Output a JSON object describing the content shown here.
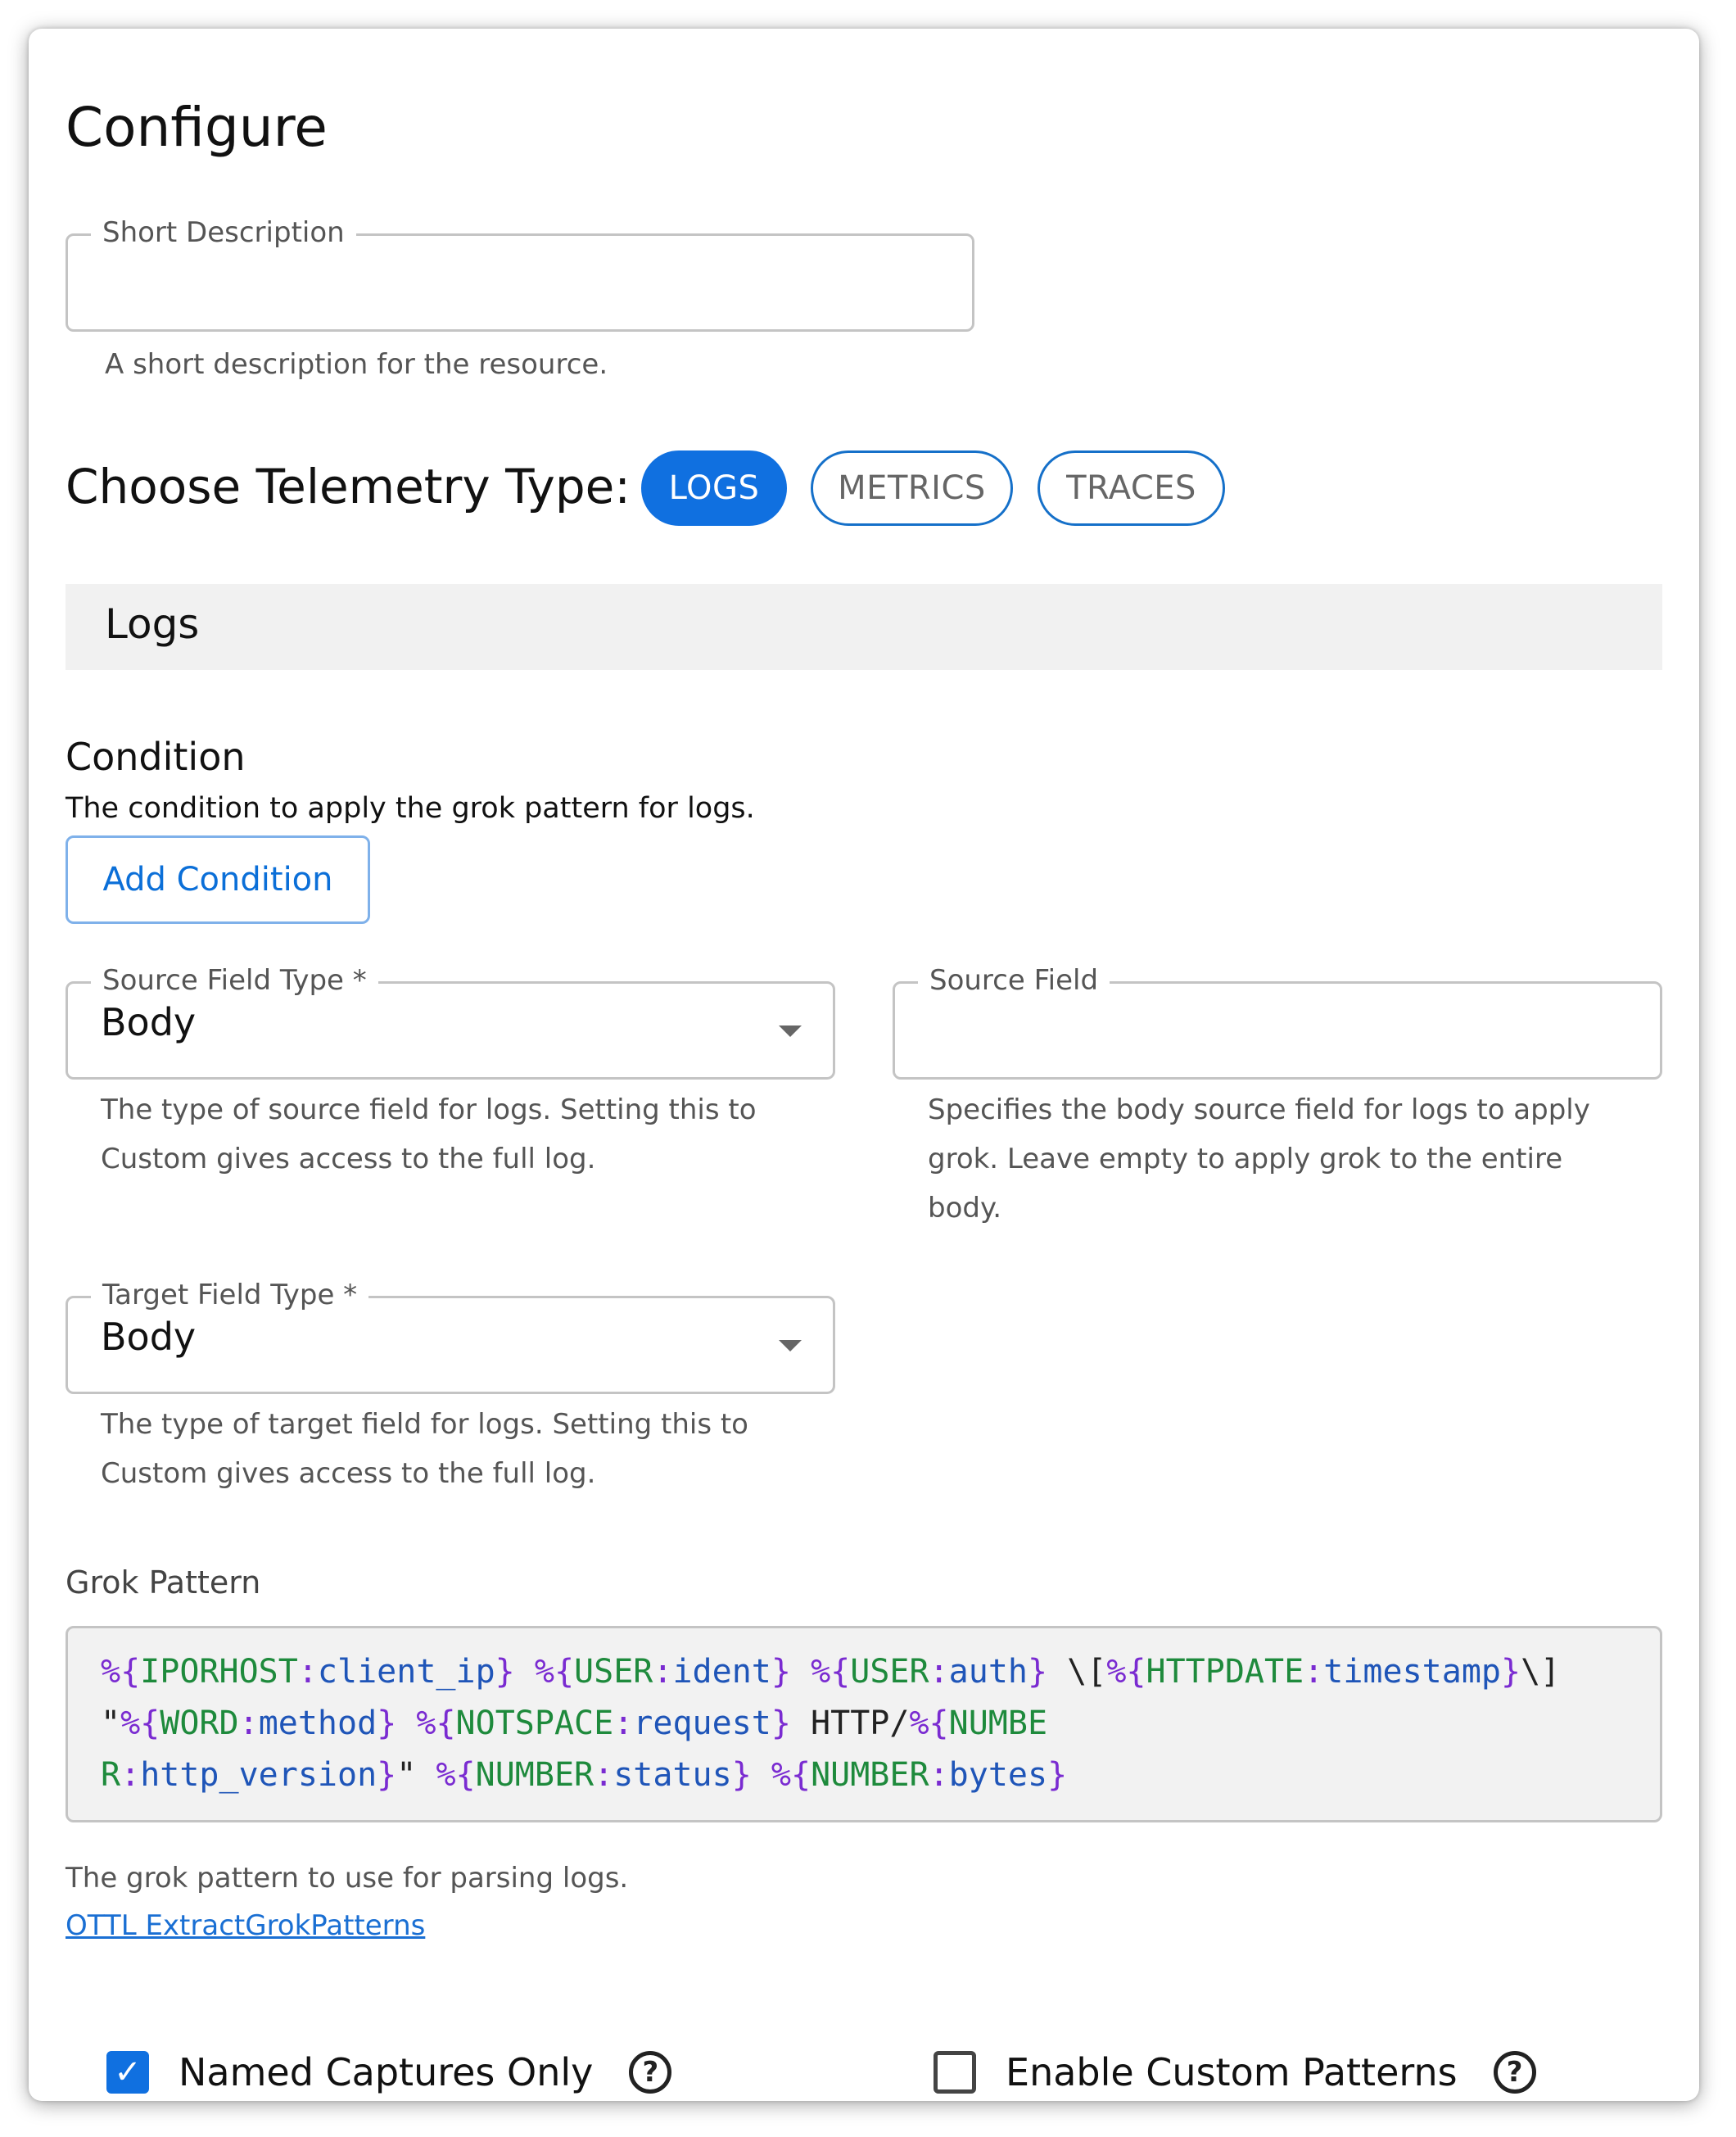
{
  "page": {
    "title": "Configure"
  },
  "short_description": {
    "label": "Short Description",
    "value": "",
    "helper": "A short description for the resource."
  },
  "telemetry": {
    "label": "Choose Telemetry Type:",
    "options": [
      {
        "label": "LOGS",
        "selected": true
      },
      {
        "label": "METRICS",
        "selected": false
      },
      {
        "label": "TRACES",
        "selected": false
      }
    ]
  },
  "logs_section": {
    "title": "Logs"
  },
  "condition": {
    "title": "Condition",
    "description": "The condition to apply the grok pattern for logs.",
    "button_label": "Add Condition"
  },
  "source_field_type": {
    "label": "Source Field Type *",
    "value": "Body",
    "helper_lines": [
      "The type of source field for logs. Setting this to",
      "Custom gives access to the full log."
    ]
  },
  "source_field": {
    "label": "Source Field",
    "value": "",
    "helper_lines": [
      "Specifies the body source field for logs to apply",
      "grok. Leave empty to apply grok to the entire",
      "body."
    ]
  },
  "target_field_type": {
    "label": "Target Field Type *",
    "value": "Body",
    "helper_lines": [
      "The type of target field for logs. Setting this to",
      "Custom gives access to the full log."
    ]
  },
  "grok": {
    "label": "Grok Pattern",
    "pattern": "%{IPORHOST:client_ip} %{USER:ident} %{USER:auth} \\[%{HTTPDATE:timestamp}\\] \"%{WORD:method} %{NOTSPACE:request} HTTP/%{NUMBER:http_version}\" %{NUMBER:status} %{NUMBER:bytes}",
    "helper": "The grok pattern to use for parsing logs.",
    "link_text": "OTTL ExtractGrokPatterns"
  },
  "options": {
    "named_captures": {
      "label": "Named Captures Only",
      "checked": true
    },
    "custom_patterns": {
      "label": "Enable Custom Patterns",
      "checked": false
    }
  },
  "colors": {
    "primary": "#1070e0",
    "code_punct": "#7a2bd1",
    "code_keyword": "#1e8a3c",
    "code_name": "#1f55b8"
  }
}
